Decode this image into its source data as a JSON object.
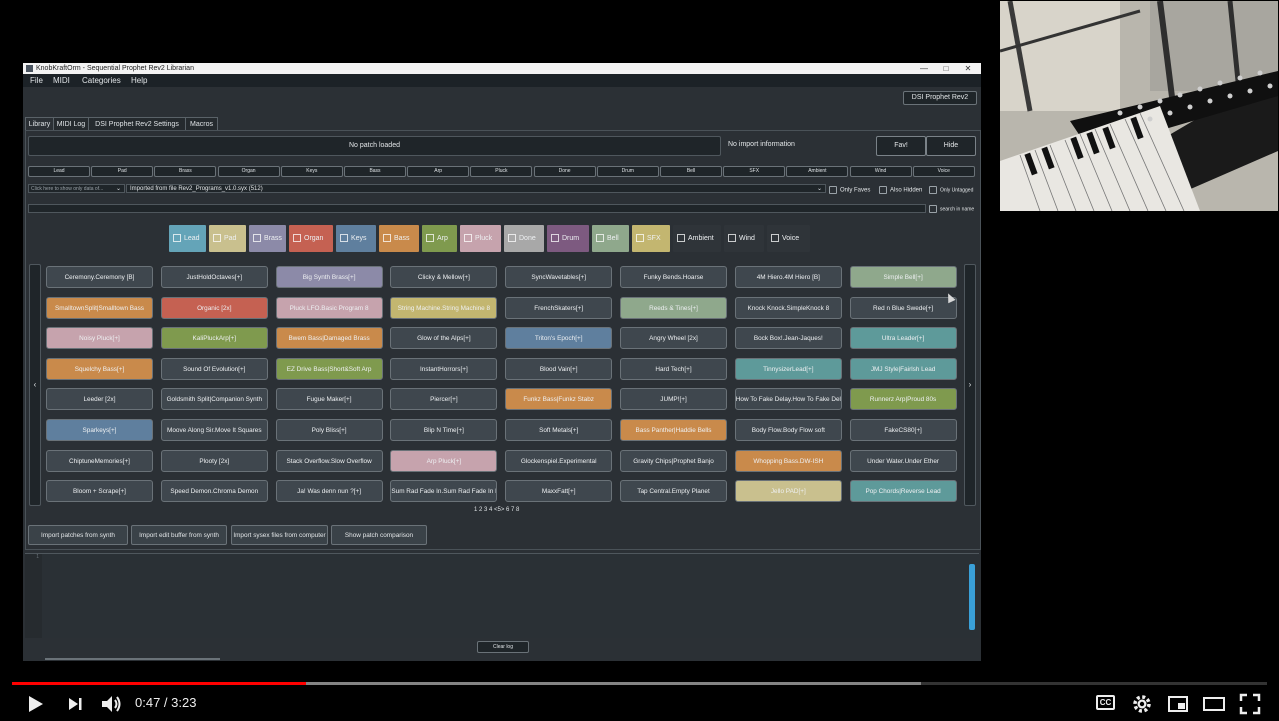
{
  "window": {
    "title": "KnobKraftOrm - Sequential Prophet Rev2 Librarian",
    "minimize": "—",
    "maximize": "□",
    "close": "✕"
  },
  "menu": [
    "File",
    "MIDI",
    "Categories",
    "Help"
  ],
  "synth_button": "DSI Prophet Rev2",
  "tabs": [
    "Library",
    "MIDI Log",
    "DSI Prophet Rev2 Settings",
    "Macros"
  ],
  "patch_info": {
    "current": "No patch loaded",
    "import_info": "No import information",
    "fav": "Fav!",
    "hide": "Hide"
  },
  "category_buttons": [
    "Lead",
    "Pad",
    "Brass",
    "Organ",
    "Keys",
    "Bass",
    "Arp",
    "Pluck",
    "Done",
    "Drum",
    "Bell",
    "SFX",
    "Ambient",
    "Wind",
    "Voice"
  ],
  "import_select": {
    "hint": "Click here to show only data of...",
    "value": "Imported from file Rev2_Programs_v1.0.syx (512)"
  },
  "checkboxes": {
    "only_faves": "Only Faves",
    "also_hidden": "Also Hidden",
    "only_untagged": "Only Untagged",
    "search_in_name": "search in name"
  },
  "filters": [
    {
      "label": "Lead",
      "color": "#64a4b8"
    },
    {
      "label": "Pad",
      "color": "#c9c08e"
    },
    {
      "label": "Brass",
      "color": "#8c8aa8"
    },
    {
      "label": "Organ",
      "color": "#c56152"
    },
    {
      "label": "Keys",
      "color": "#5f7f9e"
    },
    {
      "label": "Bass",
      "color": "#c98a4b"
    },
    {
      "label": "Arp",
      "color": "#7f9a4e"
    },
    {
      "label": "Pluck",
      "color": "#c6a3ad"
    },
    {
      "label": "Done",
      "color": "#a8a8a8"
    },
    {
      "label": "Drum",
      "color": "#7d5a80"
    },
    {
      "label": "Bell",
      "color": "#8fa88c"
    },
    {
      "label": "SFX",
      "color": "#c3b670"
    },
    {
      "label": "Ambient",
      "color": "#2f3439"
    },
    {
      "label": "Wind",
      "color": "#2f3439"
    },
    {
      "label": "Voice",
      "color": "#2f3439"
    }
  ],
  "patch_grid": {
    "prev": "‹",
    "next": "›",
    "rows": [
      [
        {
          "n": "Ceremony.Ceremony [B]",
          "c": "#3f474e"
        },
        {
          "n": "JustHoldOctaves[+]",
          "c": "#3f474e"
        },
        {
          "n": "Big Synth Brass[+]",
          "c": "#8c8aa8"
        },
        {
          "n": "Clicky & Mellow[+]",
          "c": "#3f474e"
        },
        {
          "n": "SyncWavetables[+]",
          "c": "#3f474e"
        },
        {
          "n": "Funky Bends.Hoarse",
          "c": "#3f474e"
        },
        {
          "n": "4M  Hiero.4M  Hiero [B]",
          "c": "#3f474e"
        },
        {
          "n": "Simple Bell[+]",
          "c": "#8fa88c"
        }
      ],
      [
        {
          "n": "SmalltownSplit|Smalltown Bass",
          "c": "#c98a4b"
        },
        {
          "n": "Organic [2x]",
          "c": "#c56152"
        },
        {
          "n": "Pluck LFO.Basic Program 8",
          "c": "#c6a3ad"
        },
        {
          "n": "String Machine.String Machine 8",
          "c": "#c3b670"
        },
        {
          "n": "FrenchSkaters[+]",
          "c": "#3f474e"
        },
        {
          "n": "Reeds & Tines[+]",
          "c": "#8fa88c"
        },
        {
          "n": "Knock Knock.SimpleKnock     8",
          "c": "#3f474e"
        },
        {
          "n": "Red n Blue Swede[+]",
          "c": "#3f474e"
        }
      ],
      [
        {
          "n": "Noisy Pluck[+]",
          "c": "#c6a3ad"
        },
        {
          "n": "KaliPluckArp[+]",
          "c": "#7f9a4e"
        },
        {
          "n": "Bwem Bass|Damaged Brass",
          "c": "#c98a4b"
        },
        {
          "n": "Glow of the Alps[+]",
          "c": "#3f474e"
        },
        {
          "n": "Triton's Epoch[+]",
          "c": "#5f7f9e"
        },
        {
          "n": "Angry Wheel [2x]",
          "c": "#3f474e"
        },
        {
          "n": "Bock Box!.Jean-Jaques!",
          "c": "#3f474e"
        },
        {
          "n": "Ultra Leader[+]",
          "c": "#5e9a9a"
        }
      ],
      [
        {
          "n": "Squelchy Bass[+]",
          "c": "#c98a4b"
        },
        {
          "n": "Sound Of Evolution[+]",
          "c": "#3f474e"
        },
        {
          "n": "EZ Drive Bass|Short&Soft Arp",
          "c": "#7f9a4e"
        },
        {
          "n": "InstantHorrors[+]",
          "c": "#3f474e"
        },
        {
          "n": "Blood Vain[+]",
          "c": "#3f474e"
        },
        {
          "n": "Hard Tech[+]",
          "c": "#3f474e"
        },
        {
          "n": "TinnysizerLead[+]",
          "c": "#5e9a9a"
        },
        {
          "n": "JMJ Style|Fairlsh Lead",
          "c": "#5e9a9a"
        }
      ],
      [
        {
          "n": "Leeder [2x]",
          "c": "#3f474e"
        },
        {
          "n": "Goldsmith Split|Companion Synth",
          "c": "#3f474e"
        },
        {
          "n": "Fugue  Maker[+]",
          "c": "#3f474e"
        },
        {
          "n": "Piercer[+]",
          "c": "#3f474e"
        },
        {
          "n": "Funkz Bass|Funkz Stabz",
          "c": "#c98a4b"
        },
        {
          "n": "JUMP![+]",
          "c": "#3f474e"
        },
        {
          "n": "How To Fake Delay.How To Fake Delay B",
          "c": "#3f474e"
        },
        {
          "n": "Runnerz Arp|Proud 80s",
          "c": "#7f9a4e"
        }
      ],
      [
        {
          "n": "Sparkeys[+]",
          "c": "#5f7f9e"
        },
        {
          "n": "Moove Along Sir.Move It Squares",
          "c": "#3f474e"
        },
        {
          "n": "Poly Bliss[+]",
          "c": "#3f474e"
        },
        {
          "n": "Blip N Time[+]",
          "c": "#3f474e"
        },
        {
          "n": "Soft Metals[+]",
          "c": "#3f474e"
        },
        {
          "n": "Bass Panther|Haddie Bells",
          "c": "#c98a4b"
        },
        {
          "n": "Body Flow.Body Flow  soft",
          "c": "#3f474e"
        },
        {
          "n": "FakeCS80[+]",
          "c": "#3f474e"
        }
      ],
      [
        {
          "n": "ChiptuneMemories[+]",
          "c": "#3f474e"
        },
        {
          "n": "Plooty [2x]",
          "c": "#3f474e"
        },
        {
          "n": "Stack Overflow.Slow Overflow",
          "c": "#3f474e"
        },
        {
          "n": "Arp Pluck[+]",
          "c": "#c6a3ad"
        },
        {
          "n": "Glockenspiel.Experimental",
          "c": "#3f474e"
        },
        {
          "n": "Gravity Chips|Prophet Banjo",
          "c": "#3f474e"
        },
        {
          "n": "Whopping Bass.DW-ISH",
          "c": "#c98a4b"
        },
        {
          "n": "Under Water.Under Ether",
          "c": "#3f474e"
        }
      ],
      [
        {
          "n": "Bloom + Scrape[+]",
          "c": "#3f474e"
        },
        {
          "n": "Speed Demon.Chroma Demon",
          "c": "#3f474e"
        },
        {
          "n": "Ja! Was denn nun ?[+]",
          "c": "#3f474e"
        },
        {
          "n": "Sum Rad Fade In.Sum Rad Fade In B",
          "c": "#3f474e"
        },
        {
          "n": "MaxxFatt[+]",
          "c": "#3f474e"
        },
        {
          "n": "Tap Central.Empty Planet",
          "c": "#3f474e"
        },
        {
          "n": "Jello PAD[+]",
          "c": "#c9c08e"
        },
        {
          "n": "Pop Chords|Reverse Lead",
          "c": "#5e9a9a"
        }
      ]
    ]
  },
  "pagination": "1 2 3 4 <5> 6 7 8",
  "bottom_buttons": [
    "Import patches from synth",
    "Import edit buffer from synth",
    "Import sysex files from computer",
    "Show patch comparison"
  ],
  "log": {
    "line": "1",
    "clear": "Clear log"
  },
  "player": {
    "time": "0:47 / 3:23",
    "progress": 0.234,
    "buffered": 0.724,
    "cc": "CC"
  }
}
